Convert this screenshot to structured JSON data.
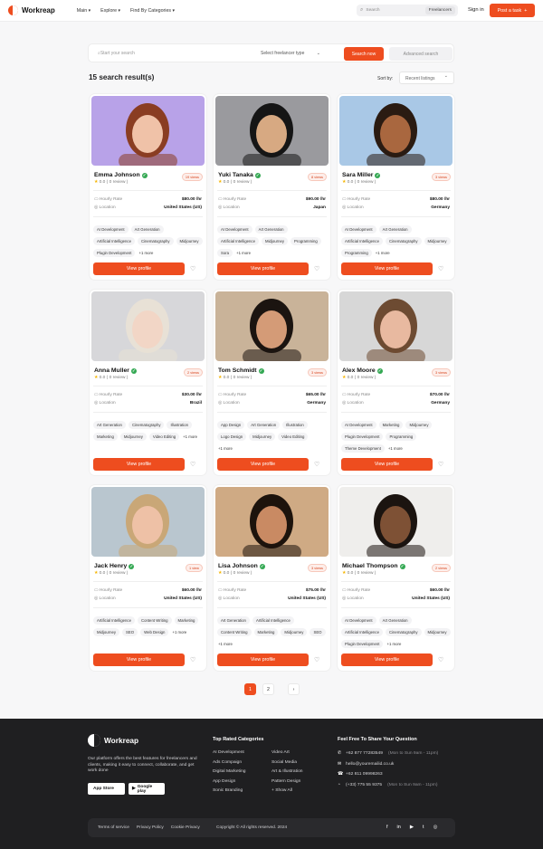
{
  "nav": {
    "brand": "Workreap",
    "menu": [
      "Main",
      "Explore",
      "Find By Categories"
    ],
    "search_placeholder": "Search",
    "search_scope": "Freelancers",
    "signin": "Sign in",
    "post_task": "Post a task"
  },
  "search": {
    "placeholder": "Start your search",
    "type": "Select freelancer type",
    "button": "Search now",
    "advanced": "Advanced search"
  },
  "results_label": "15 search result(s)",
  "sort": {
    "label": "Sort by:",
    "value": "Recent listings"
  },
  "card_labels": {
    "hourly_rate": "Hourly Rate",
    "location": "Location",
    "view_profile": "View profile"
  },
  "cards": [
    {
      "name": "Emma Johnson",
      "views": "19 views",
      "rating": "0.0",
      "reviews": "( 0 review )",
      "rate": "$80.00 /hr",
      "location": "United States (US)",
      "tags": [
        "AI Development",
        "Art Generation",
        "Artificial Intelligence",
        "Cinematography",
        "Midjourney",
        "Plugin Development"
      ],
      "more": "+1 more"
    },
    {
      "name": "Yuki Tanaka",
      "views": "8 views",
      "rating": "0.0",
      "reviews": "( 0 review )",
      "rate": "$90.00 /hr",
      "location": "Japan",
      "tags": [
        "AI Development",
        "Art Generation",
        "Artificial Intelligence",
        "Midjourney",
        "Programming",
        "Sora"
      ],
      "more": "+1 more"
    },
    {
      "name": "Sara Miller",
      "views": "3 views",
      "rating": "0.0",
      "reviews": "( 0 review )",
      "rate": "$80.00 /hr",
      "location": "Germany",
      "tags": [
        "AI Development",
        "Art Generation",
        "Artificial Intelligence",
        "Cinematography",
        "Midjourney",
        "Programming"
      ],
      "more": "+1 more"
    },
    {
      "name": "Anna Muller",
      "views": "2 views",
      "rating": "0.0",
      "reviews": "( 0 review )",
      "rate": "$30.00 /hr",
      "location": "Brazil",
      "tags": [
        "Art Generation",
        "Cinematography",
        "Illustration",
        "Marketing",
        "Midjourney",
        "Video Editing"
      ],
      "more": "+1 more"
    },
    {
      "name": "Tom Schmidt",
      "views": "3 views",
      "rating": "0.0",
      "reviews": "( 0 review )",
      "rate": "$65.00 /hr",
      "location": "Germany",
      "tags": [
        "App Design",
        "Art Generation",
        "Illustration",
        "Logo Design",
        "Midjourney",
        "Video Editing"
      ],
      "more": "+1 more"
    },
    {
      "name": "Alex Moore",
      "views": "3 views",
      "rating": "0.0",
      "reviews": "( 0 review )",
      "rate": "$70.00 /hr",
      "location": "Germany",
      "tags": [
        "AI Development",
        "Marketing",
        "Midjourney",
        "Plugin Development",
        "Programming",
        "Theme Development"
      ],
      "more": "+1 more"
    },
    {
      "name": "Jack Henry",
      "views": "1 view",
      "rating": "0.0",
      "reviews": "( 0 review )",
      "rate": "$60.00 /hr",
      "location": "United States (US)",
      "tags": [
        "Artificial Intelligence",
        "Content Writing",
        "Marketing",
        "Midjourney",
        "SEO",
        "Web Design"
      ],
      "more": "+1 more"
    },
    {
      "name": "Lisa Johnson",
      "views": "3 views",
      "rating": "0.0",
      "reviews": "( 0 review )",
      "rate": "$75.00 /hr",
      "location": "United States (US)",
      "tags": [
        "Art Generation",
        "Artificial Intelligence",
        "Content Writing",
        "Marketing",
        "Midjourney",
        "SEO"
      ],
      "more": "+1 more"
    },
    {
      "name": "Michael Thompson",
      "views": "2 views",
      "rating": "0.0",
      "reviews": "( 0 review )",
      "rate": "$60.00 /hr",
      "location": "United States (US)",
      "tags": [
        "AI Development",
        "Art Generation",
        "Artificial Intelligence",
        "Cinematography",
        "Midjourney",
        "Plugin Development"
      ],
      "more": "+1 more"
    }
  ],
  "photos": [
    {
      "bg": "#b8a2e8",
      "skin": "#f0c2a8",
      "hair": "#8a3d22"
    },
    {
      "bg": "#9a9a9e",
      "skin": "#d7a982",
      "hair": "#151515"
    },
    {
      "bg": "#a9c8e6",
      "skin": "#a9673f",
      "hair": "#2a1b12"
    },
    {
      "bg": "#d7d7da",
      "skin": "#f2d6c6",
      "hair": "#e8e1d6"
    },
    {
      "bg": "#c9b399",
      "skin": "#d49b77",
      "hair": "#1b1410"
    },
    {
      "bg": "#d7d7d7",
      "skin": "#e8b9a0",
      "hair": "#6d4b32"
    },
    {
      "bg": "#b9c6cf",
      "skin": "#eec1a6",
      "hair": "#c9a777"
    },
    {
      "bg": "#cfaa84",
      "skin": "#c98a63",
      "hair": "#1d130c"
    },
    {
      "bg": "#efeeec",
      "skin": "#7e5135",
      "hair": "#1b1410"
    }
  ],
  "pagination": [
    "1",
    "2",
    "›"
  ],
  "footer": {
    "brand": "Workreap",
    "description": "Our platform offers the best features for freelancers and clients, making it easy to connect, collaborate, and get work done",
    "app_store": "App Store",
    "google_play": "Google play",
    "categories_title": "Top Rated Categories",
    "categories_col1": [
      "AI Development",
      "Ads Compaign",
      "Digital Marketing",
      "App Design",
      "Sonic Branding"
    ],
    "categories_col2": [
      "Video Art",
      "Social Media",
      "Art & Illustration",
      "Pattern Design",
      "+ Show All"
    ],
    "contact_title": "Feel Free To Share Your Question",
    "phone1": "+62 877 77283549",
    "phone1_hours": "(Mon to Sun 9am - 11pm)",
    "email": "hello@youremailid.co.uk",
    "phone2": "+62 811 09998263",
    "phone3": "(+33) 775 55 9375",
    "phone3_hours": "(Mon to Sun 9am - 11pm)",
    "links": [
      "Terms of service",
      "Privacy Policy",
      "Cookie Privacy"
    ],
    "copyright": "Copyright © All rights reserved. 2024",
    "social": [
      "f",
      "in",
      "▶",
      "t",
      "◎"
    ]
  },
  "colors": {
    "accent": "#ee4d1f",
    "footer_bg": "#1f1f21",
    "verified": "#34a853"
  }
}
